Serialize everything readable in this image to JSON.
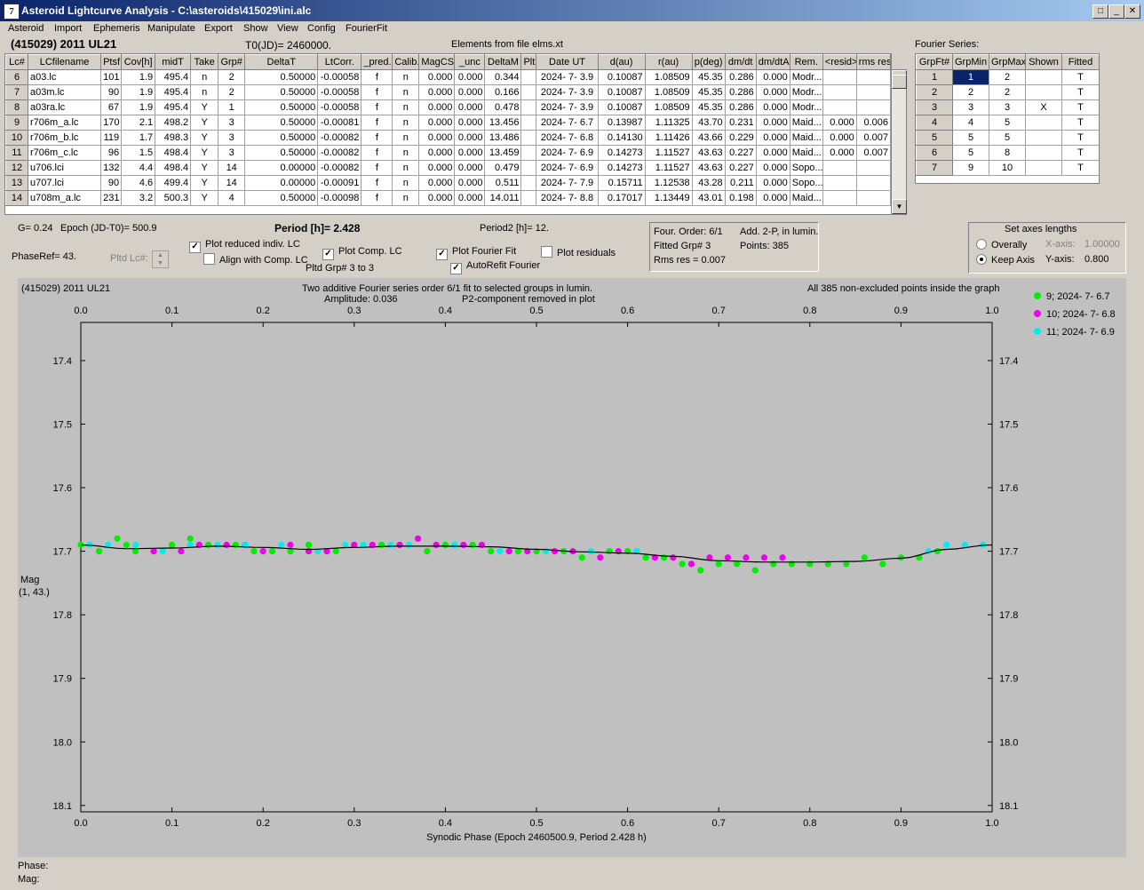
{
  "window": {
    "title": "Asteroid Lightcurve Analysis - C:\\asteroids\\415029\\ini.alc",
    "icon": "app-logo-icon"
  },
  "menu": [
    "Asteroid",
    "Import",
    "Ephemeris",
    "Manipulate",
    "Export",
    "Show",
    "View",
    "Config",
    "FourierFit"
  ],
  "header": {
    "asteroid": "(415029) 2011 UL21",
    "t0": "T0(JD)= 2460000.",
    "elements": "Elements from file elms.xt",
    "fourier_label": "Fourier Series:"
  },
  "lc_table": {
    "columns": [
      "Lc#",
      "LCfilename",
      "Ptsf",
      "Cov[h]",
      "midT",
      "Take",
      "Grp#",
      "DeltaT",
      "LtCorr.",
      "_pred.",
      "Calib.",
      "MagCS",
      "_unc",
      "DeltaM",
      "Plt",
      "Date UT",
      "d(au)",
      "r(au)",
      "p(deg)",
      "dm/dt",
      "dm/dtA",
      "Rem.",
      "<resid>",
      "rms res"
    ],
    "rows": [
      [
        "6",
        "a03.lc",
        "101",
        "1.9",
        "495.4",
        "n",
        "2",
        "0.50000",
        "-0.00058",
        "f",
        "n",
        "0.000",
        "0.000",
        "0.344",
        "",
        "2024- 7- 3.9",
        "0.10087",
        "1.08509",
        "45.35",
        "0.286",
        "0.000",
        "Modr...",
        "",
        ""
      ],
      [
        "7",
        "a03m.lc",
        "90",
        "1.9",
        "495.4",
        "n",
        "2",
        "0.50000",
        "-0.00058",
        "f",
        "n",
        "0.000",
        "0.000",
        "0.166",
        "",
        "2024- 7- 3.9",
        "0.10087",
        "1.08509",
        "45.35",
        "0.286",
        "0.000",
        "Modr...",
        "",
        ""
      ],
      [
        "8",
        "a03ra.lc",
        "67",
        "1.9",
        "495.4",
        "Y",
        "1",
        "0.50000",
        "-0.00058",
        "f",
        "n",
        "0.000",
        "0.000",
        "0.478",
        "",
        "2024- 7- 3.9",
        "0.10087",
        "1.08509",
        "45.35",
        "0.286",
        "0.000",
        "Modr...",
        "",
        ""
      ],
      [
        "9",
        "r706m_a.lc",
        "170",
        "2.1",
        "498.2",
        "Y",
        "3",
        "0.50000",
        "-0.00081",
        "f",
        "n",
        "0.000",
        "0.000",
        "13.456",
        "",
        "2024- 7- 6.7",
        "0.13987",
        "1.11325",
        "43.70",
        "0.231",
        "0.000",
        "Maid...",
        "0.000",
        "0.006"
      ],
      [
        "10",
        "r706m_b.lc",
        "119",
        "1.7",
        "498.3",
        "Y",
        "3",
        "0.50000",
        "-0.00082",
        "f",
        "n",
        "0.000",
        "0.000",
        "13.486",
        "",
        "2024- 7- 6.8",
        "0.14130",
        "1.11426",
        "43.66",
        "0.229",
        "0.000",
        "Maid...",
        "0.000",
        "0.007"
      ],
      [
        "11",
        "r706m_c.lc",
        "96",
        "1.5",
        "498.4",
        "Y",
        "3",
        "0.50000",
        "-0.00082",
        "f",
        "n",
        "0.000",
        "0.000",
        "13.459",
        "",
        "2024- 7- 6.9",
        "0.14273",
        "1.11527",
        "43.63",
        "0.227",
        "0.000",
        "Maid...",
        "0.000",
        "0.007"
      ],
      [
        "12",
        "u706.lci",
        "132",
        "4.4",
        "498.4",
        "Y",
        "14",
        "0.00000",
        "-0.00082",
        "f",
        "n",
        "0.000",
        "0.000",
        "0.479",
        "",
        "2024- 7- 6.9",
        "0.14273",
        "1.11527",
        "43.63",
        "0.227",
        "0.000",
        "Sopo...",
        "",
        ""
      ],
      [
        "13",
        "u707.lci",
        "90",
        "4.6",
        "499.4",
        "Y",
        "14",
        "0.00000",
        "-0.00091",
        "f",
        "n",
        "0.000",
        "0.000",
        "0.511",
        "",
        "2024- 7- 7.9",
        "0.15711",
        "1.12538",
        "43.28",
        "0.211",
        "0.000",
        "Sopo...",
        "",
        ""
      ],
      [
        "14",
        "u708m_a.lc",
        "231",
        "3.2",
        "500.3",
        "Y",
        "4",
        "0.50000",
        "-0.00098",
        "f",
        "n",
        "0.000",
        "0.000",
        "14.011",
        "",
        "2024- 7- 8.8",
        "0.17017",
        "1.13449",
        "43.01",
        "0.198",
        "0.000",
        "Maid...",
        "",
        ""
      ]
    ]
  },
  "fourier_table": {
    "columns": [
      "GrpFt#",
      "GrpMin",
      "GrpMax",
      "Shown",
      "Fitted"
    ],
    "rows": [
      [
        "1",
        "1",
        "2",
        "",
        "T"
      ],
      [
        "2",
        "2",
        "2",
        "",
        "T"
      ],
      [
        "3",
        "3",
        "3",
        "X",
        "T"
      ],
      [
        "4",
        "4",
        "5",
        "",
        "T"
      ],
      [
        "5",
        "5",
        "5",
        "",
        "T"
      ],
      [
        "6",
        "5",
        "8",
        "",
        "T"
      ],
      [
        "7",
        "9",
        "10",
        "",
        "T"
      ]
    ]
  },
  "controls": {
    "g": "G= 0.24",
    "epoch": "Epoch (JD-T0)= 500.9",
    "period": "Period [h]= 2.428",
    "period2": "Period2 [h]= 12.",
    "phaseref": "PhaseRef= 43.",
    "pltd_lc": "Pltd Lc#:",
    "plot_reduced": "Plot reduced indiv. LC",
    "align": "Align with Comp. LC",
    "plot_comp": "Plot Comp. LC",
    "pltd_grp": "Pltd Grp#  3  to  3",
    "plot_fourier": "Plot Fourier Fit",
    "plot_residuals": "Plot residuals",
    "autorefit": "AutoRefit Fourier",
    "four_order": "Four. Order:  6/1",
    "add2p": "Add. 2-P, in lumin.",
    "fitted_grp": "Fitted Grp# 3",
    "points": "Points: 385",
    "rms": "Rms res      = 0.007",
    "axes_title": "Set axes lengths",
    "overally": "Overally",
    "keep_axis": "Keep Axis",
    "xaxis_label": "X-axis:",
    "xaxis_val": "1.00000",
    "yaxis_label": "Y-axis:",
    "yaxis_val": "0.800"
  },
  "plot": {
    "name": "(415029) 2011 UL21",
    "line1": "Two additive Fourier series order 6/1 fit to selected groups in lumin.",
    "amplitude": "Amplitude: 0.036",
    "p2": "P2-component removed in plot",
    "points_note": "All 385 non-excluded points inside the graph",
    "ylabel1": "Mag",
    "ylabel2": "(1, 43.)",
    "phase_label": "Phase:",
    "mag_label": "Mag:"
  },
  "chart_data": {
    "type": "scatter",
    "xlabel": "Synodic Phase (Epoch 2460500.9, Period 2.428 h)",
    "ylabel": "Mag",
    "xlim": [
      0.0,
      1.0
    ],
    "ylim": [
      17.34,
      18.11
    ],
    "y_inverted": true,
    "x_ticks": [
      "0.0",
      "0.1",
      "0.2",
      "0.3",
      "0.4",
      "0.5",
      "0.6",
      "0.7",
      "0.8",
      "0.9",
      "1.0"
    ],
    "y_ticks": [
      "17.4",
      "17.5",
      "17.6",
      "17.7",
      "17.8",
      "17.9",
      "18.0",
      "18.1"
    ],
    "legend_position": "top-right",
    "series": [
      {
        "name": "9; 2024- 7- 6.7",
        "color": "#00ee00",
        "x": [
          0.0,
          0.02,
          0.04,
          0.05,
          0.06,
          0.08,
          0.1,
          0.12,
          0.14,
          0.17,
          0.19,
          0.21,
          0.23,
          0.25,
          0.28,
          0.3,
          0.33,
          0.35,
          0.38,
          0.4,
          0.43,
          0.45,
          0.48,
          0.5,
          0.53,
          0.55,
          0.58,
          0.6,
          0.62,
          0.64,
          0.66,
          0.68,
          0.7,
          0.72,
          0.74,
          0.76,
          0.78,
          0.8,
          0.82,
          0.84,
          0.86,
          0.88,
          0.9,
          0.92,
          0.94
        ],
        "y": [
          17.69,
          17.7,
          17.68,
          17.69,
          17.7,
          17.7,
          17.69,
          17.68,
          17.69,
          17.69,
          17.7,
          17.7,
          17.7,
          17.69,
          17.7,
          17.69,
          17.69,
          17.69,
          17.7,
          17.69,
          17.69,
          17.7,
          17.7,
          17.7,
          17.7,
          17.71,
          17.7,
          17.7,
          17.71,
          17.71,
          17.72,
          17.73,
          17.72,
          17.72,
          17.73,
          17.72,
          17.72,
          17.72,
          17.72,
          17.72,
          17.71,
          17.72,
          17.71,
          17.71,
          17.7
        ]
      },
      {
        "name": "10; 2024- 7- 6.8",
        "color": "#ee00ee",
        "x": [
          0.08,
          0.11,
          0.13,
          0.16,
          0.18,
          0.2,
          0.23,
          0.25,
          0.27,
          0.3,
          0.32,
          0.35,
          0.37,
          0.39,
          0.42,
          0.44,
          0.47,
          0.49,
          0.52,
          0.54,
          0.57,
          0.59,
          0.61,
          0.63,
          0.65,
          0.67,
          0.69,
          0.71,
          0.73,
          0.75,
          0.77
        ],
        "y": [
          17.7,
          17.7,
          17.69,
          17.69,
          17.69,
          17.7,
          17.69,
          17.7,
          17.7,
          17.69,
          17.69,
          17.69,
          17.68,
          17.69,
          17.69,
          17.69,
          17.7,
          17.7,
          17.7,
          17.7,
          17.71,
          17.7,
          17.7,
          17.71,
          17.71,
          17.72,
          17.71,
          17.71,
          17.71,
          17.71,
          17.71
        ]
      },
      {
        "name": "11; 2024- 7- 6.9",
        "color": "#00eeee",
        "x": [
          0.01,
          0.03,
          0.06,
          0.09,
          0.12,
          0.15,
          0.18,
          0.22,
          0.26,
          0.29,
          0.31,
          0.34,
          0.36,
          0.41,
          0.46,
          0.51,
          0.56,
          0.61,
          0.93,
          0.95,
          0.97,
          0.99
        ],
        "y": [
          17.69,
          17.69,
          17.69,
          17.7,
          17.69,
          17.69,
          17.69,
          17.69,
          17.7,
          17.69,
          17.69,
          17.69,
          17.69,
          17.69,
          17.7,
          17.7,
          17.7,
          17.7,
          17.7,
          17.69,
          17.69,
          17.69
        ]
      }
    ],
    "fit_curve": {
      "color": "#000000",
      "x": [
        0.0,
        0.05,
        0.1,
        0.15,
        0.2,
        0.25,
        0.3,
        0.35,
        0.4,
        0.45,
        0.5,
        0.55,
        0.6,
        0.65,
        0.7,
        0.75,
        0.8,
        0.85,
        0.9,
        0.95,
        1.0
      ],
      "y": [
        17.69,
        17.696,
        17.695,
        17.692,
        17.694,
        17.697,
        17.694,
        17.692,
        17.692,
        17.693,
        17.697,
        17.701,
        17.703,
        17.708,
        17.715,
        17.717,
        17.717,
        17.716,
        17.711,
        17.697,
        17.69
      ]
    }
  }
}
